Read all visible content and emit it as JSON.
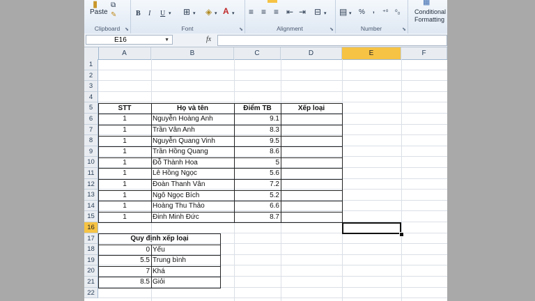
{
  "ribbon": {
    "clipboard": {
      "paste": "Paste",
      "label": "Clipboard"
    },
    "font": {
      "label": "Font",
      "bold": "B",
      "italic": "I",
      "underline": "U"
    },
    "alignment": {
      "label": "Alignment"
    },
    "number": {
      "label": "Number",
      "percent": "%",
      "comma": ","
    },
    "styles": {
      "conditional_line1": "Conditional",
      "conditional_line2": "Formatting"
    },
    "icons": [
      "paste-icon",
      "copy-icon",
      "format-painter-icon",
      "borders-icon",
      "fill-color-icon",
      "font-color-icon",
      "align-left-icon",
      "align-center-icon",
      "align-right-icon",
      "merge-icon",
      "currency-icon",
      "increase-decimal-icon",
      "decrease-decimal-icon",
      "conditional-formatting-icon"
    ]
  },
  "formula_bar": {
    "name_box": "E16",
    "fx": "fx",
    "content": ""
  },
  "columns": [
    "A",
    "B",
    "C",
    "D",
    "E",
    "F"
  ],
  "rows": [
    "1",
    "2",
    "3",
    "4",
    "5",
    "6",
    "7",
    "8",
    "9",
    "10",
    "11",
    "12",
    "13",
    "14",
    "15",
    "16",
    "17",
    "18",
    "19",
    "20",
    "21",
    "22"
  ],
  "selected": {
    "column": "E",
    "row": "16"
  },
  "table": {
    "headers": {
      "stt": "STT",
      "name": "Họ và tên",
      "score": "Điểm TB",
      "rank": "Xếp loại"
    },
    "rows": [
      {
        "stt": "1",
        "name": "Nguyễn Hoàng Anh",
        "score": "9.1"
      },
      {
        "stt": "1",
        "name": "Trần Vân Anh",
        "score": "8.3"
      },
      {
        "stt": "1",
        "name": "Nguyễn Quang Vinh",
        "score": "9.5"
      },
      {
        "stt": "1",
        "name": "Trần Hồng Quang",
        "score": "8.6"
      },
      {
        "stt": "1",
        "name": "Đỗ Thành Hoa",
        "score": "5"
      },
      {
        "stt": "1",
        "name": "Lê Hồng Ngọc",
        "score": "5.6"
      },
      {
        "stt": "1",
        "name": "Đoàn Thanh Vân",
        "score": "7.2"
      },
      {
        "stt": "1",
        "name": "Ngô Ngọc Bích",
        "score": "5.2"
      },
      {
        "stt": "1",
        "name": "Hoàng Thu Thảo",
        "score": "6.6"
      },
      {
        "stt": "1",
        "name": "Đinh Minh Đức",
        "score": "8.7"
      }
    ]
  },
  "rules": {
    "title": "Quy định xếp loại",
    "rows": [
      {
        "min": "0",
        "label": "Yếu"
      },
      {
        "min": "5.5",
        "label": "Trung bình"
      },
      {
        "min": "7",
        "label": "Khá"
      },
      {
        "min": "8.5",
        "label": "Giỏi"
      }
    ]
  }
}
